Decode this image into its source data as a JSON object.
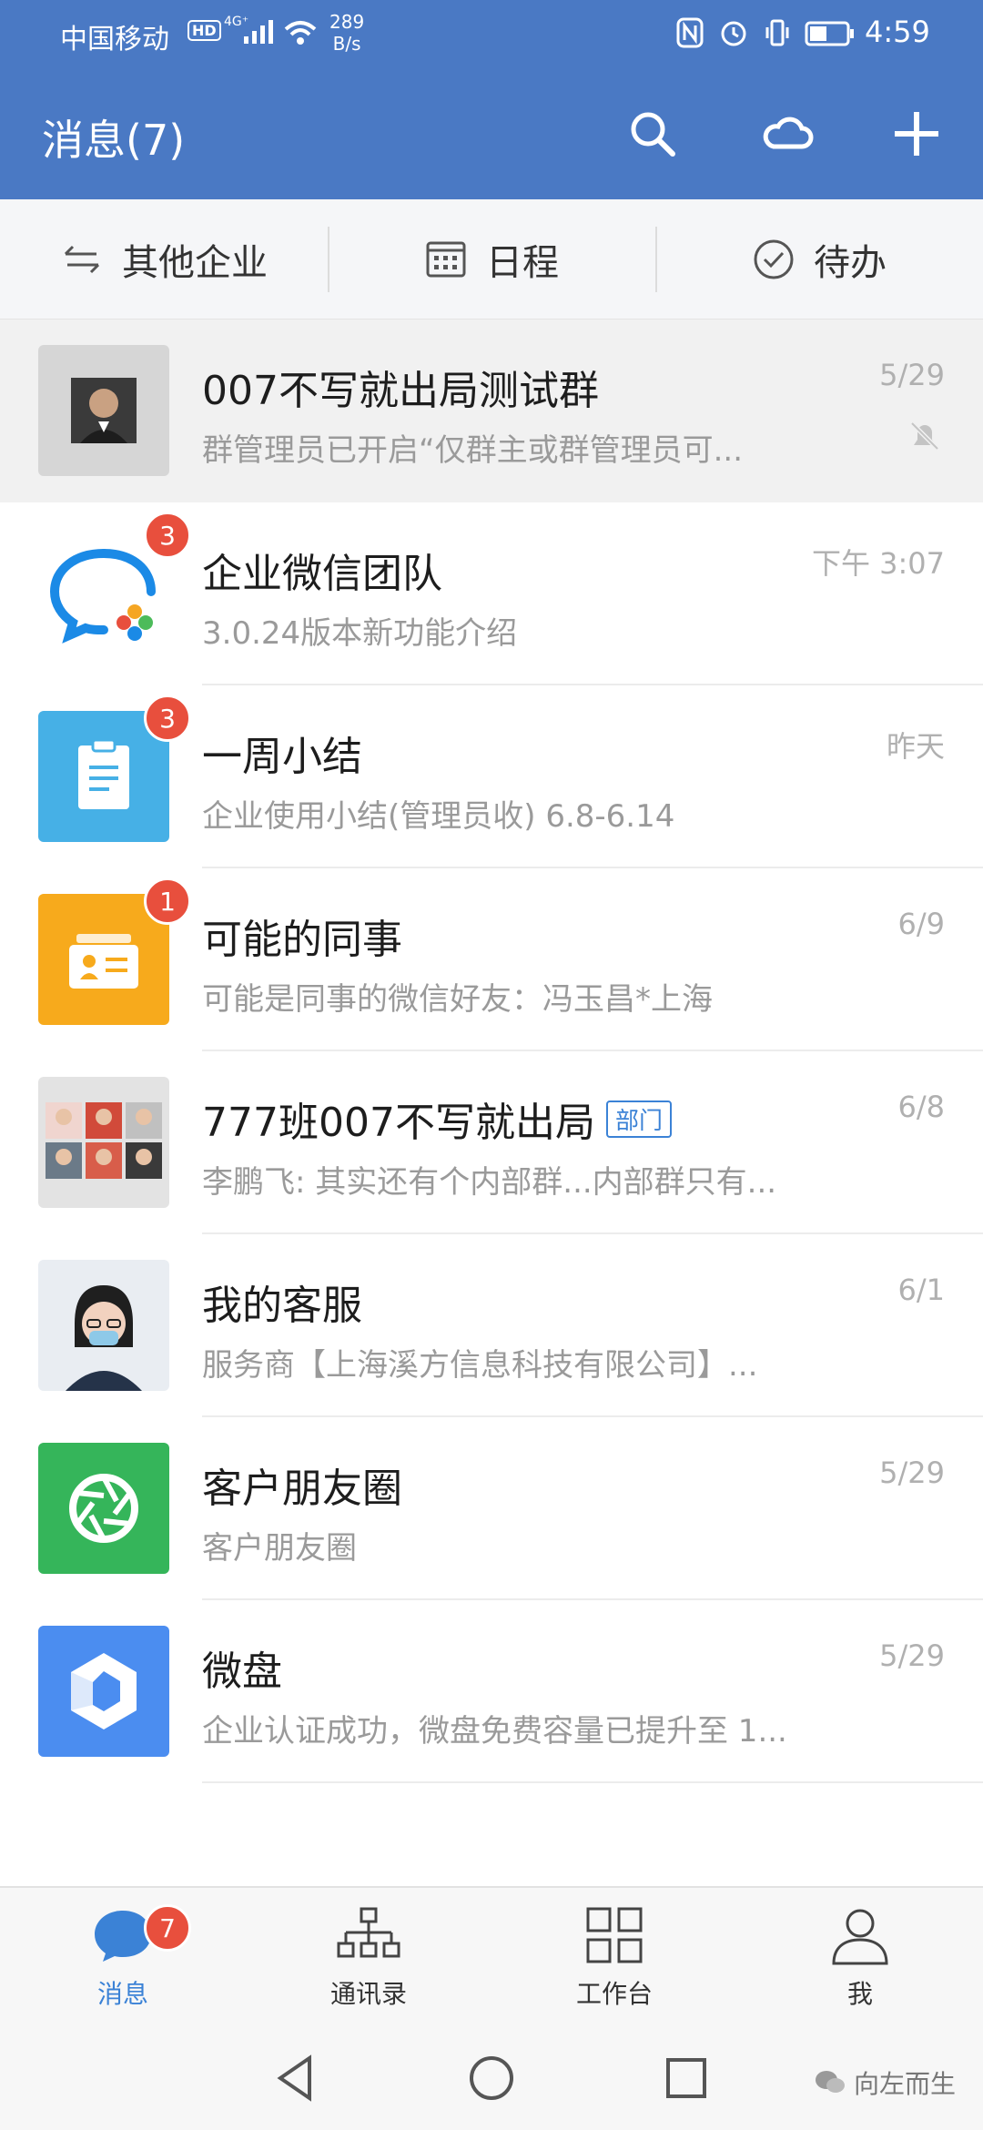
{
  "status_bar": {
    "carrier": "中国移动",
    "hd": "HD",
    "network": "4G⁺",
    "speed_value": "289",
    "speed_unit": "B/s",
    "time": "4:59"
  },
  "header": {
    "title": "消息(7)",
    "icons": [
      "search-icon",
      "cloud-icon",
      "plus-icon"
    ]
  },
  "quickbar": [
    {
      "label": "其他企业",
      "icon": "switch-icon"
    },
    {
      "label": "日程",
      "icon": "calendar-icon"
    },
    {
      "label": "待办",
      "icon": "check-circle-icon"
    }
  ],
  "chats": [
    {
      "title": "007不写就出局测试群",
      "subtitle": "群管理员已开启“仅群主或群管理员可...",
      "time": "5/29",
      "badge": "",
      "muted": true,
      "pinned": true,
      "avatar": "person-photo"
    },
    {
      "title": "企业微信团队",
      "subtitle": "3.0.24版本新功能介绍",
      "time": "下午 3:07",
      "badge": "3",
      "avatar": "wecom-logo"
    },
    {
      "title": "一周小结",
      "subtitle": "企业使用小结(管理员收) 6.8-6.14",
      "time": "昨天",
      "badge": "3",
      "avatar": "clipboard-icon"
    },
    {
      "title": "可能的同事",
      "subtitle": "可能是同事的微信好友：冯玉昌*上海",
      "time": "6/9",
      "badge": "1",
      "avatar": "contact-card-icon"
    },
    {
      "title": "777班007不写就出局",
      "tag": "部门",
      "subtitle": "李鹏飞: 其实还有个内部群...内部群只有...",
      "time": "6/8",
      "badge": "",
      "avatar": "group-collage"
    },
    {
      "title": "我的客服",
      "subtitle": "服务商【上海溪方信息科技有限公司】...",
      "time": "6/1",
      "badge": "",
      "avatar": "service-photo"
    },
    {
      "title": "客户朋友圈",
      "subtitle": "客户朋友圈",
      "time": "5/29",
      "badge": "",
      "avatar": "aperture-icon"
    },
    {
      "title": "微盘",
      "subtitle": "企业认证成功，微盘免费容量已提升至 1...",
      "time": "5/29",
      "badge": "",
      "avatar": "weipan-icon"
    }
  ],
  "bottom_tabs": [
    {
      "label": "消息",
      "badge": "7",
      "active": true
    },
    {
      "label": "通讯录"
    },
    {
      "label": "工作台"
    },
    {
      "label": "我"
    }
  ],
  "watermark": "向左而生",
  "colors": {
    "brand": "#4a79c4",
    "accent": "#3b82d6",
    "badge": "#e84f3d"
  }
}
